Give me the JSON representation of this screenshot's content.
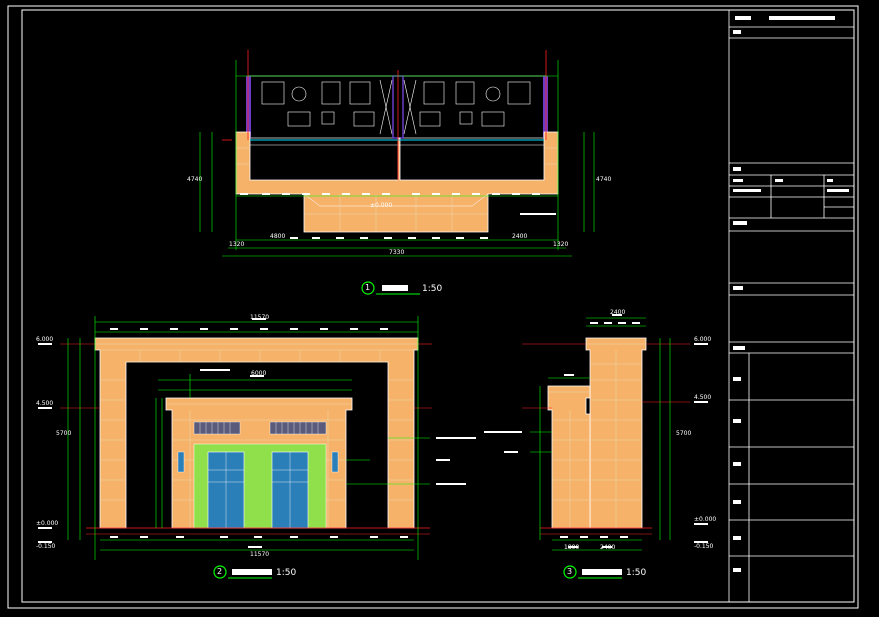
{
  "drawing": {
    "views": [
      {
        "number": "1",
        "scale": "1:50"
      },
      {
        "number": "2",
        "scale": "1:50"
      },
      {
        "number": "3",
        "scale": "1:50"
      }
    ],
    "plan_dims": {
      "bottom_total": "7330",
      "bottom_left": "1320",
      "bottom_right": "1320",
      "mid_left": "4800",
      "mid_right": "2400",
      "left_vert": "4740",
      "right_vert": "4740",
      "top_left": "4800",
      "level": "±0.000"
    },
    "front_dims": {
      "top_total": "11570",
      "bottom_total": "11570",
      "inner_top": "6000",
      "level_top": "6.000",
      "level_mid": "4.500",
      "level_zero": "±0.000",
      "level_low": "-0.150",
      "height": "5700"
    },
    "side_dims": {
      "top_total": "2400",
      "bottom_a": "1800",
      "bottom_b": "2400",
      "level_top": "6.000",
      "level_mid": "4.500",
      "level_zero": "±0.000",
      "level_low": "-0.150",
      "height": "5700"
    }
  },
  "colors": {
    "background": "#000000",
    "frame": "#ffffff",
    "wall_fill": "#f7b26a",
    "wall_grid": "#e8d8a8",
    "dimension": "#00ff00",
    "axis_red": "#ff2020",
    "door_glass": "#2b7fb8",
    "door_panel": "#8fe04a",
    "accent_purple": "#6a3cc8",
    "accent_cyan": "#00e5ff"
  }
}
